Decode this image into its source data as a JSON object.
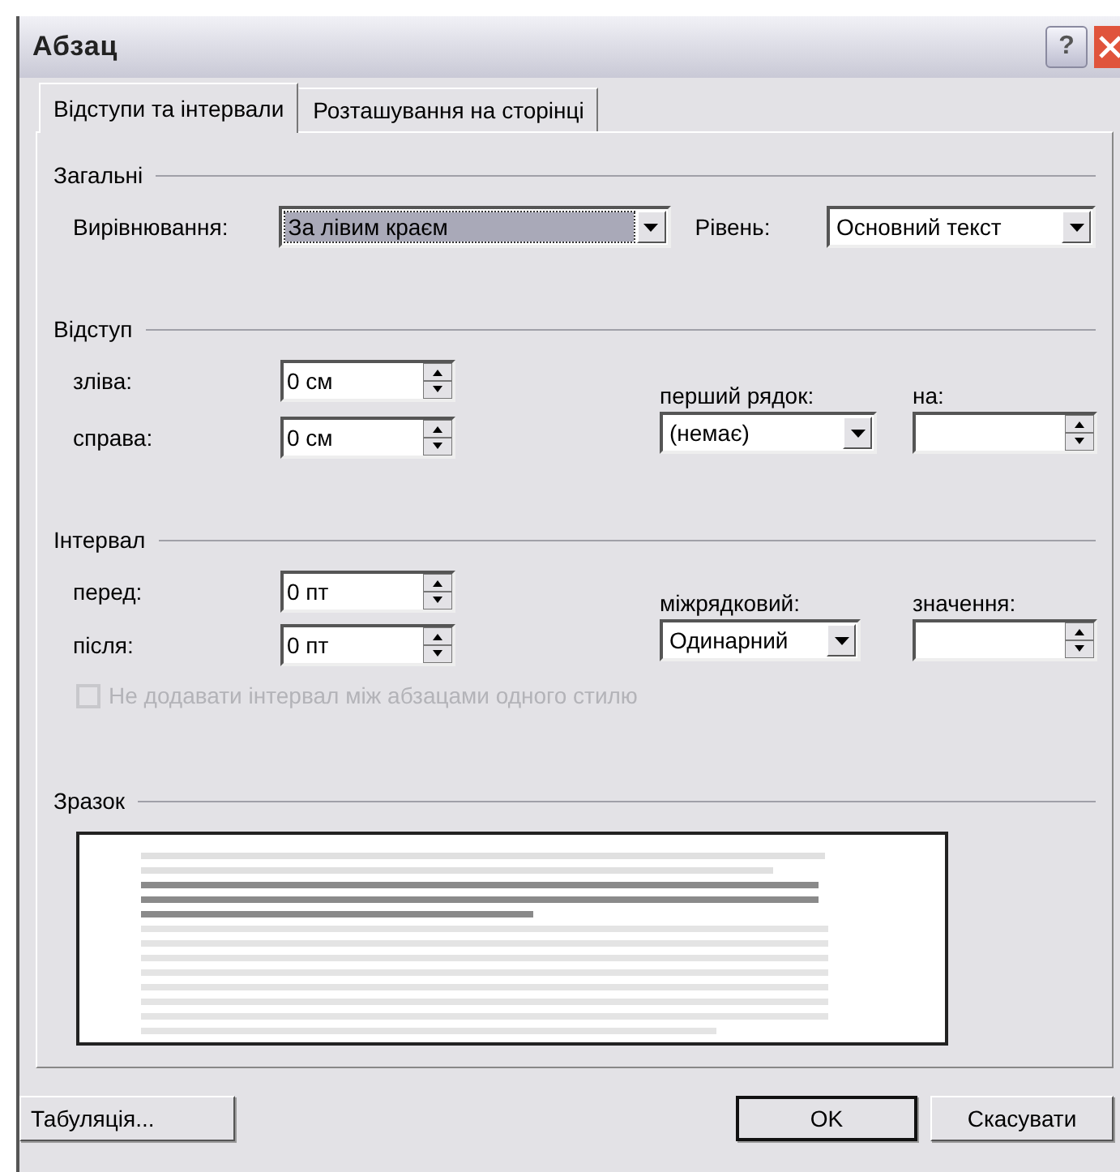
{
  "window": {
    "title": "Абзац",
    "help_button": "?"
  },
  "tabs": [
    {
      "label": "Відступи та інтервали",
      "selected": true
    },
    {
      "label": "Розташування на сторінці",
      "selected": false
    }
  ],
  "general": {
    "title": "Загальні",
    "alignment": {
      "label": "Вирівнювання:",
      "value": "За лівим краєм",
      "focused": true
    },
    "outline_level": {
      "label": "Рівень:",
      "value": "Основний текст",
      "focused": false
    }
  },
  "indentation": {
    "title": "Відступ",
    "left": {
      "label": "зліва:",
      "value": "0 см"
    },
    "right": {
      "label": "справа:",
      "value": "0 см"
    },
    "special": {
      "label": "перший рядок:",
      "value": "(немає)",
      "focused": false
    },
    "by": {
      "label": "на:"
    }
  },
  "spacing": {
    "title": "Інтервал",
    "before": {
      "label": "перед:",
      "value": "0 пт"
    },
    "after": {
      "label": "після:",
      "value": "0 пт"
    },
    "line_spacing": {
      "label": "міжрядковий:",
      "value": "Одинарний",
      "focused": false
    },
    "at": {
      "label": "значення:"
    },
    "no_space_same_style": {
      "label": "Не додавати інтервал між абзацами одного стилю",
      "checked": false,
      "disabled": true
    }
  },
  "preview": {
    "title": "Зразок"
  },
  "buttons": [
    {
      "label": "Табуляція...",
      "default": false
    },
    {
      "label": "OK",
      "default": true
    },
    {
      "label": "Скасувати",
      "default": false
    }
  ]
}
